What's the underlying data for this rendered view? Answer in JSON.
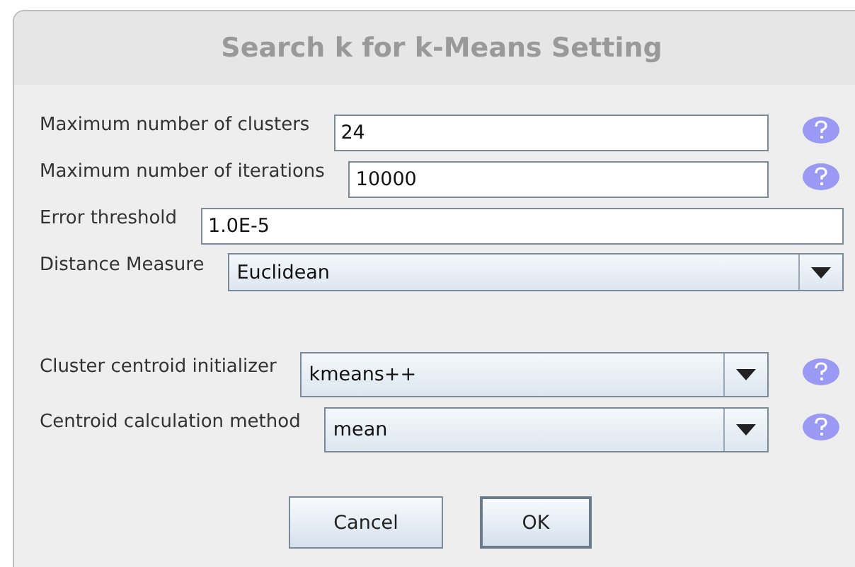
{
  "dialog": {
    "title": "Search k for k-Means Setting"
  },
  "fields": [
    {
      "kind": "text",
      "label": "Maximum number of clusters",
      "value": "24",
      "help": true
    },
    {
      "kind": "text",
      "label": "Maximum number of iterations",
      "value": "10000",
      "help": true
    },
    {
      "kind": "text",
      "label": "Error threshold",
      "value": "1.0E-5",
      "help": false
    },
    {
      "kind": "combo",
      "label": "Distance Measure",
      "value": "Euclidean",
      "help": false
    },
    {
      "kind": "spacer"
    },
    {
      "kind": "combo",
      "label": "Cluster centroid initializer",
      "value": "kmeans++",
      "help": true
    },
    {
      "kind": "combo",
      "label": "Centroid calculation method",
      "value": "mean",
      "help": true
    }
  ],
  "buttons": [
    {
      "label": "Cancel",
      "default": false
    },
    {
      "label": "OK",
      "default": true
    }
  ]
}
